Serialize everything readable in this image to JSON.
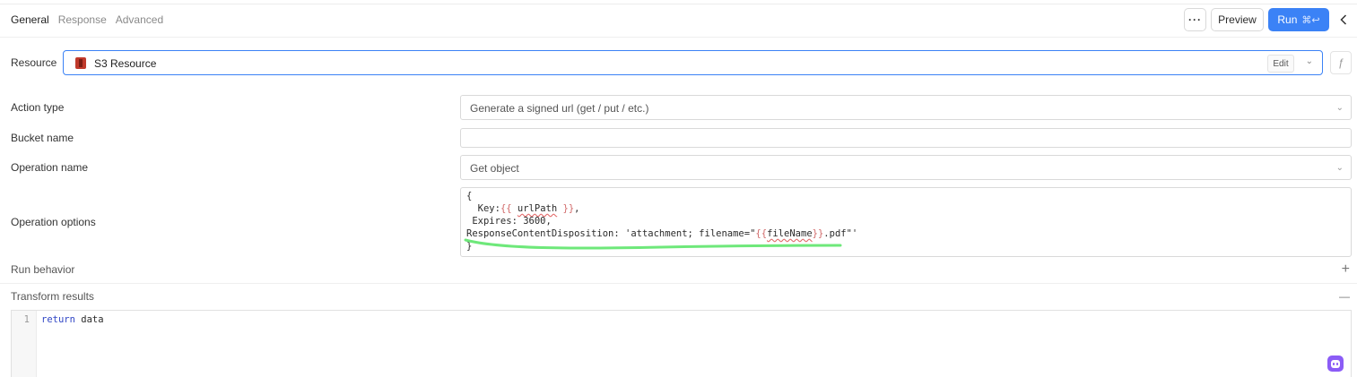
{
  "tabs": [
    {
      "label": "General",
      "active": true
    },
    {
      "label": "Response",
      "active": false
    },
    {
      "label": "Advanced",
      "active": false
    }
  ],
  "header": {
    "more_label": "···",
    "preview_label": "Preview",
    "run_label": "Run",
    "run_shortcut": "⌘↩",
    "collapse_icon": "chevron-left-icon"
  },
  "resource": {
    "label": "Resource",
    "value": "S3 Resource",
    "edit_label": "Edit",
    "icon": "s3-bucket-icon",
    "fx_label": "ƒ"
  },
  "form": {
    "action_type": {
      "label": "Action type",
      "value": "Generate a signed url (get / put / etc.)"
    },
    "bucket_name": {
      "label": "Bucket name",
      "value": ""
    },
    "operation_name": {
      "label": "Operation name",
      "value": "Get object"
    },
    "operation_options": {
      "label": "Operation options",
      "lines": {
        "l1": "{",
        "l2_key": "  Key:",
        "l2_open": "{{ ",
        "l2_var": "urlPath",
        "l2_close": " }}",
        "l2_end": ",",
        "l3": " Expires: 3600,",
        "l4_pre": "ResponseContentDisposition: 'attachment; filename=\"",
        "l4_open": "{{",
        "l4_var": "fileName",
        "l4_close": "}}",
        "l4_post": ".pdf\"'",
        "l5": "}"
      }
    }
  },
  "sections": {
    "run_behavior": {
      "label": "Run behavior",
      "toggle": "+"
    },
    "transform_results": {
      "label": "Transform results",
      "toggle": "—"
    }
  },
  "transform_editor": {
    "line_number": "1",
    "keyword": "return",
    "rest": " data"
  },
  "colors": {
    "accent": "#3b82f6",
    "highlight_green": "#6ee87a",
    "assistant": "#8b5cf6"
  }
}
